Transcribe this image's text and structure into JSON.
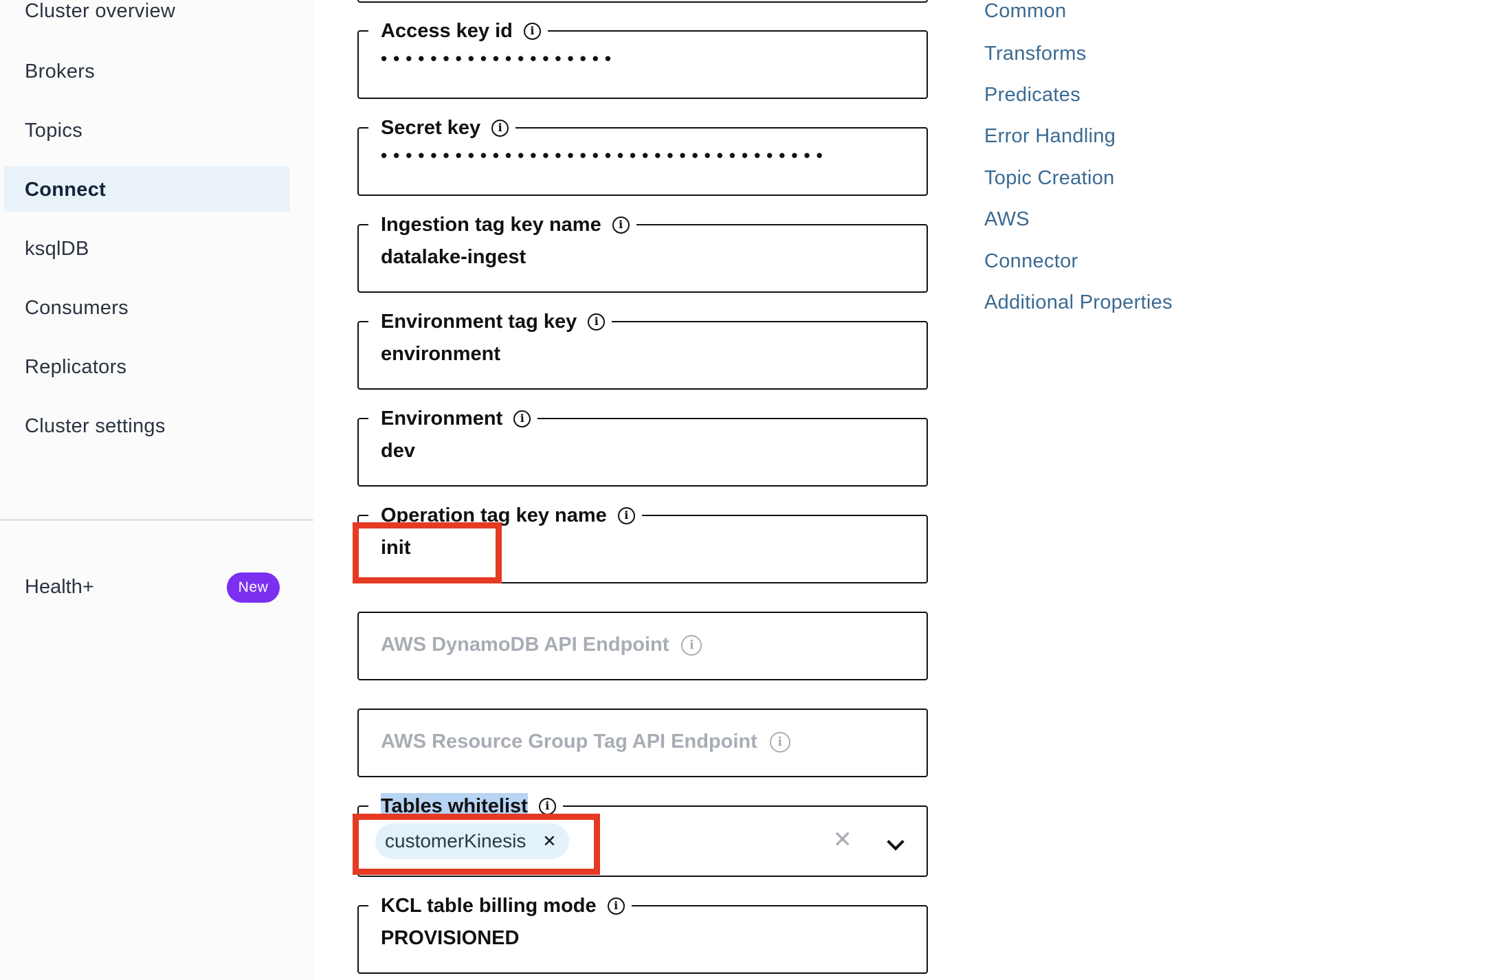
{
  "sidebar": {
    "items": [
      {
        "label": "Cluster overview"
      },
      {
        "label": "Brokers"
      },
      {
        "label": "Topics"
      },
      {
        "label": "Connect"
      },
      {
        "label": "ksqlDB"
      },
      {
        "label": "Consumers"
      },
      {
        "label": "Replicators"
      },
      {
        "label": "Cluster settings"
      }
    ],
    "active": "Connect",
    "health": {
      "label": "Health+",
      "badge": "New"
    }
  },
  "form": {
    "access_key_id": {
      "label": "Access key id",
      "value": "•••••••••••••••••••"
    },
    "secret_key": {
      "label": "Secret key",
      "value": "••••••••••••••••••••••••••••••••••••"
    },
    "ingestion_tag_key_name": {
      "label": "Ingestion tag key name",
      "value": "datalake-ingest"
    },
    "environment_tag_key": {
      "label": "Environment tag key",
      "value": "environment"
    },
    "environment": {
      "label": "Environment",
      "value": "dev"
    },
    "operation_tag_key_name": {
      "label": "Operation tag key name",
      "value": "init"
    },
    "dynamodb_endpoint": {
      "placeholder": "AWS DynamoDB API Endpoint"
    },
    "resource_group_endpoint": {
      "placeholder": "AWS Resource Group Tag API Endpoint"
    },
    "tables_whitelist": {
      "label": "Tables whitelist",
      "chips": [
        "customerKinesis"
      ]
    },
    "kcl_table_billing_mode": {
      "label": "KCL table billing mode",
      "value": "PROVISIONED"
    }
  },
  "toc": {
    "items": [
      "Common",
      "Transforms",
      "Predicates",
      "Error Handling",
      "Topic Creation",
      "AWS",
      "Connector",
      "Additional Properties"
    ]
  },
  "colors": {
    "link": "#3b6a92",
    "active_bg": "#e9f2f9",
    "badge": "#7b2ff0",
    "annotation_red": "#e53a23",
    "selection": "#b7d4f2"
  },
  "icons": {
    "info": "info-circle-icon",
    "remove_chip": "close-icon",
    "clear": "clear-icon",
    "dropdown": "chevron-down-icon"
  }
}
